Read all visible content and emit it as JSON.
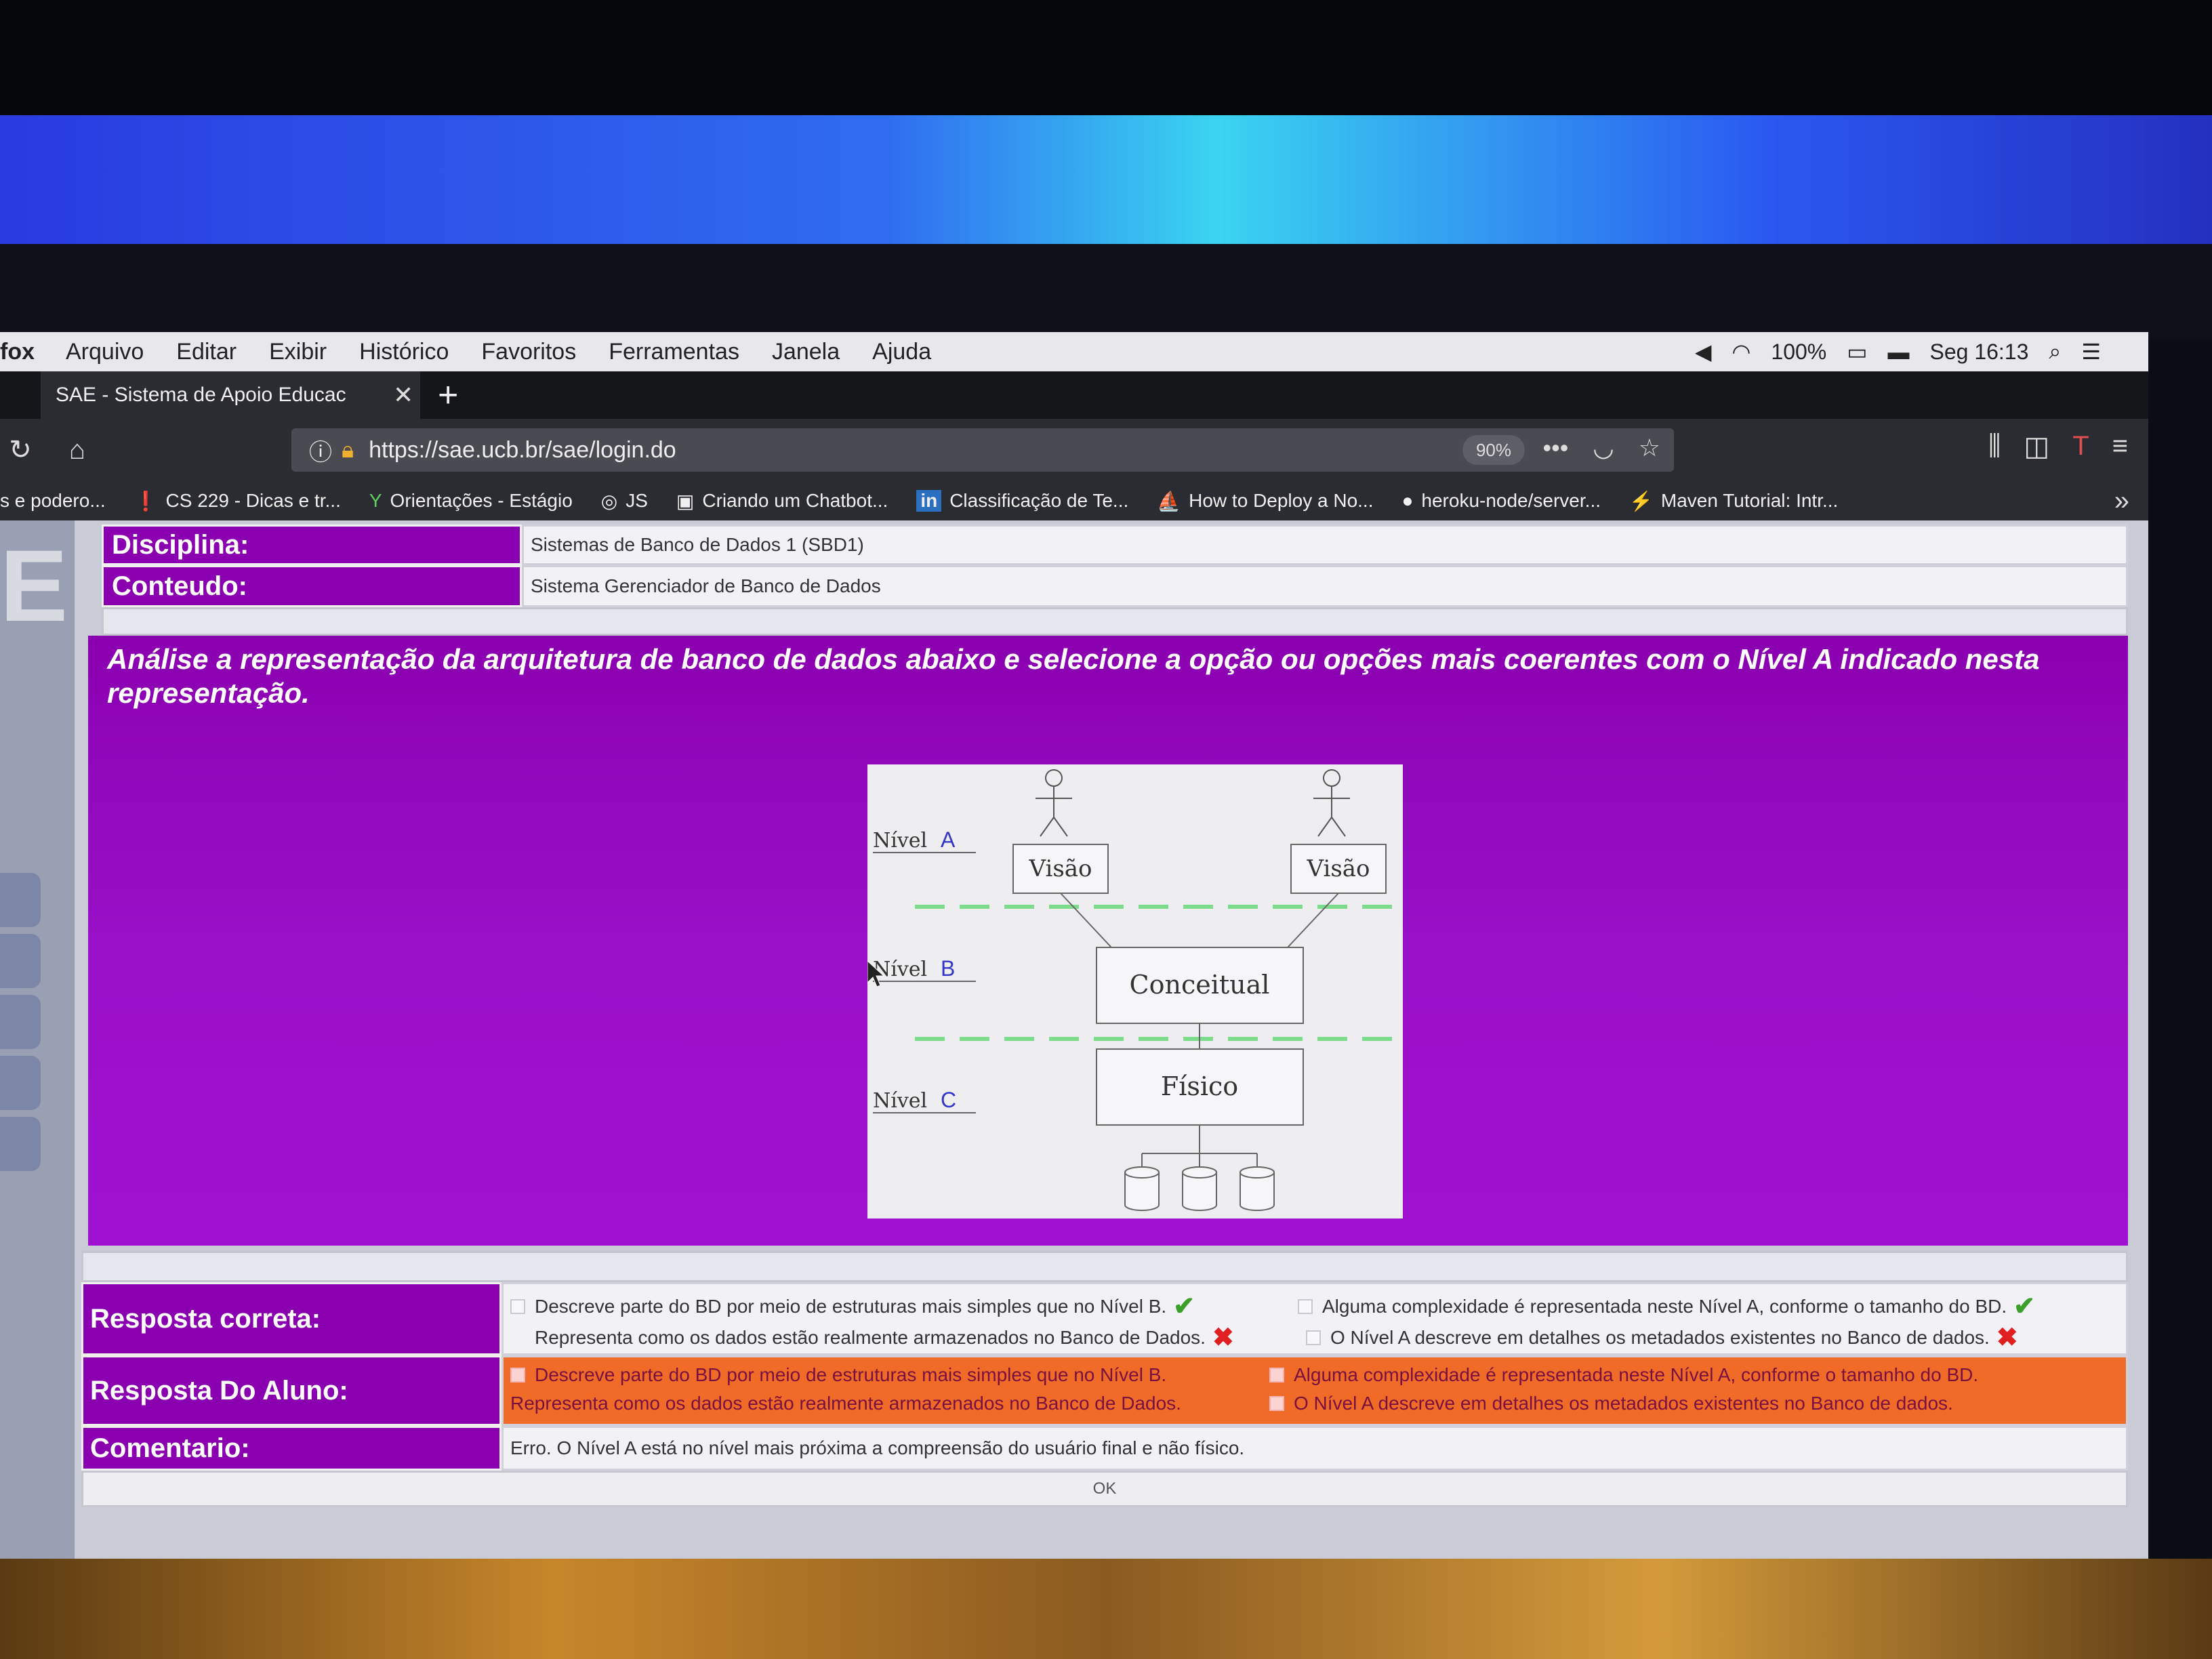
{
  "menubar": {
    "app": "fox",
    "items": [
      "Arquivo",
      "Editar",
      "Exibir",
      "Histórico",
      "Favoritos",
      "Ferramentas",
      "Janela",
      "Ajuda"
    ],
    "battery": "100%",
    "clock": "Seg 16:13"
  },
  "tab": {
    "title": "SAE - Sistema de Apoio Educac",
    "close": "✕",
    "new": "+"
  },
  "nav": {
    "url": "https://sae.ucb.br/sae/login.do",
    "zoom": "90%",
    "more": "•••"
  },
  "bookmarks": [
    {
      "icon": "",
      "label": "s e podero..."
    },
    {
      "icon": "❗",
      "label": "CS 229 - Dicas e tr..."
    },
    {
      "icon": "Y",
      "label": "Orientações - Estágio"
    },
    {
      "icon": "◎",
      "label": "JS"
    },
    {
      "icon": "▣",
      "label": "Criando um Chatbot..."
    },
    {
      "icon": "in",
      "label": "Classificação de Te..."
    },
    {
      "icon": "⛵",
      "label": "How to Deploy a No..."
    },
    {
      "icon": "●",
      "label": "heroku-node/server..."
    },
    {
      "icon": "⚡",
      "label": "Maven Tutorial: Intr..."
    }
  ],
  "bookmarks_more": "»",
  "rail": {
    "logo": "E"
  },
  "info": {
    "disciplina_label": "Disciplina:",
    "disciplina_value": "Sistemas de Banco de Dados 1 (SBD1)",
    "conteudo_label": "Conteudo:",
    "conteudo_value": "Sistema Gerenciador de Banco de Dados"
  },
  "question": {
    "text": "Análise a representação da arquitetura de banco de dados abaixo e selecione a opção ou opções mais coerentes com o Nível A indicado nesta representação."
  },
  "figure": {
    "level_a": "Nível",
    "level_a_letter": "A",
    "level_b": "Nível",
    "level_b_letter": "B",
    "level_c": "Nível",
    "level_c_letter": "C",
    "view_left": "Visão",
    "view_right": "Visão",
    "conceptual": "Conceitual",
    "physical": "Físico",
    "dash_color": "#7ddc8c"
  },
  "answers": {
    "correct_label": "Resposta correta:",
    "student_label": "Resposta Do Aluno:",
    "comment_label": "Comentario:",
    "options": [
      {
        "text": "Descreve parte do BD por meio de estruturas mais simples que no Nível B.",
        "correct": true
      },
      {
        "text": "Alguma complexidade é representada neste Nível A, conforme o tamanho do BD.",
        "correct": true
      },
      {
        "text": "Representa como os dados estão realmente armazenados no Banco de Dados.",
        "correct": false
      },
      {
        "text": "O Nível A descreve em detalhes os metadados existentes no Banco de dados.",
        "correct": false
      }
    ],
    "student_options": [
      {
        "text": "Descreve parte do BD por meio de estruturas mais simples que no Nível B."
      },
      {
        "text": "Alguma complexidade é representada neste Nível A, conforme o tamanho do BD."
      },
      {
        "text": "Representa como os dados estão realmente armazenados no Banco de Dados."
      },
      {
        "text": "O Nível A descreve em detalhes os metadados existentes no Banco de dados."
      }
    ],
    "comment": "Erro. O Nível A está no nível mais próxima a compreensão do usuário final e não físico.",
    "ok_label": "OK"
  },
  "colors": {
    "purple": "#8a00b0",
    "orange": "#f06a28",
    "check_green": "#3aa02a",
    "cross_red": "#e02020"
  }
}
